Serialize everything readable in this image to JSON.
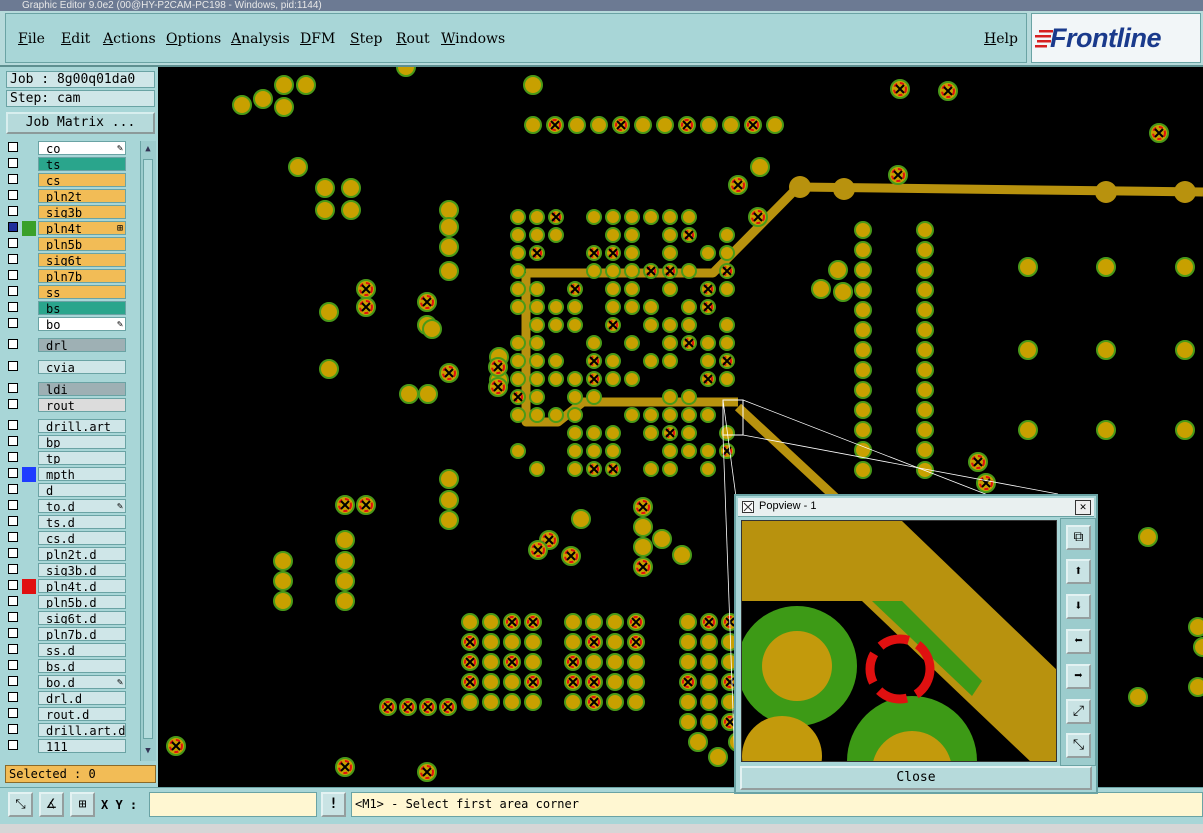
{
  "window": {
    "title": "Graphic Editor 9.0e2 (00@HY-P2CAM-PC198 - Windows, pid:1144)"
  },
  "menu": [
    "File",
    "Edit",
    "Actions",
    "Options",
    "Analysis",
    "DFM",
    "Step",
    "Rout",
    "Windows"
  ],
  "help_label": "Help",
  "logo": {
    "text": "Frontline",
    "color": "#1a3a8c",
    "accent": "#d62020"
  },
  "job": {
    "job_label": "Job : 8g00q01da0",
    "step_label": "Step: cam"
  },
  "job_matrix_label": "Job Matrix ...",
  "layers": [
    {
      "name": "co",
      "bg": "#ffffff",
      "flag": "✎",
      "marker": ""
    },
    {
      "name": "ts",
      "bg": "#2aa58c",
      "flag": "",
      "marker": ""
    },
    {
      "name": "cs",
      "bg": "#f2bc56",
      "flag": "",
      "marker": ""
    },
    {
      "name": "pln2t",
      "bg": "#f2bc56",
      "flag": "",
      "marker": ""
    },
    {
      "name": "sig3b",
      "bg": "#f2bc56",
      "flag": "",
      "marker": ""
    },
    {
      "name": "pln4t",
      "bg": "#f2bc56",
      "flag": "⊞",
      "marker": "#1e2f9c",
      "marker2": "#3aa02a"
    },
    {
      "name": "pln5b",
      "bg": "#f2bc56",
      "flag": "",
      "marker": ""
    },
    {
      "name": "sig6t",
      "bg": "#f2bc56",
      "flag": "",
      "marker": ""
    },
    {
      "name": "pln7b",
      "bg": "#f2bc56",
      "flag": "",
      "marker": ""
    },
    {
      "name": "ss",
      "bg": "#f2bc56",
      "flag": "",
      "marker": ""
    },
    {
      "name": "bs",
      "bg": "#2aa58c",
      "flag": "",
      "marker": ""
    },
    {
      "name": "bo",
      "bg": "#ffffff",
      "flag": "✎",
      "marker": ""
    },
    {
      "name": "drl",
      "bg": "#9eb0b4",
      "flag": "",
      "marker": ""
    },
    {
      "name": "cvia",
      "bg": "#cfe6e8",
      "flag": "",
      "marker": ""
    },
    {
      "name": "ldi",
      "bg": "#9eb0b4",
      "flag": "",
      "marker": ""
    },
    {
      "name": "rout",
      "bg": "#dcdcdc",
      "flag": "",
      "marker": ""
    },
    {
      "name": "drill.art",
      "bg": "#cfe6e8",
      "flag": "",
      "marker": ""
    },
    {
      "name": "bp",
      "bg": "#cfe6e8",
      "flag": "",
      "marker": ""
    },
    {
      "name": "tp",
      "bg": "#cfe6e8",
      "flag": "",
      "marker": ""
    },
    {
      "name": "mpth",
      "bg": "#cfe6e8",
      "flag": "",
      "marker": "#1e3cff"
    },
    {
      "name": "d",
      "bg": "#cfe6e8",
      "flag": "",
      "marker": ""
    },
    {
      "name": "to.d",
      "bg": "#cfe6e8",
      "flag": "✎",
      "marker": ""
    },
    {
      "name": "ts.d",
      "bg": "#cfe6e8",
      "flag": "",
      "marker": ""
    },
    {
      "name": "cs.d",
      "bg": "#cfe6e8",
      "flag": "",
      "marker": ""
    },
    {
      "name": "pln2t.d",
      "bg": "#cfe6e8",
      "flag": "",
      "marker": ""
    },
    {
      "name": "sig3b.d",
      "bg": "#cfe6e8",
      "flag": "",
      "marker": ""
    },
    {
      "name": "pln4t.d",
      "bg": "#cfe6e8",
      "flag": "",
      "marker": "#e01010"
    },
    {
      "name": "pln5b.d",
      "bg": "#cfe6e8",
      "flag": "",
      "marker": ""
    },
    {
      "name": "sig6t.d",
      "bg": "#cfe6e8",
      "flag": "",
      "marker": ""
    },
    {
      "name": "pln7b.d",
      "bg": "#cfe6e8",
      "flag": "",
      "marker": ""
    },
    {
      "name": "ss.d",
      "bg": "#cfe6e8",
      "flag": "",
      "marker": ""
    },
    {
      "name": "bs.d",
      "bg": "#cfe6e8",
      "flag": "",
      "marker": ""
    },
    {
      "name": "bo.d",
      "bg": "#cfe6e8",
      "flag": "✎",
      "marker": ""
    },
    {
      "name": "drl.d",
      "bg": "#cfe6e8",
      "flag": "",
      "marker": ""
    },
    {
      "name": "rout.d",
      "bg": "#cfe6e8",
      "flag": "",
      "marker": ""
    },
    {
      "name": "drill.art.d",
      "bg": "#cfe6e8",
      "flag": "",
      "marker": ""
    },
    {
      "name": "111",
      "bg": "#cfe6e8",
      "flag": "",
      "marker": ""
    }
  ],
  "selected_label": "Selected : 0",
  "bottom": {
    "xy_label": "X Y :",
    "xy_value": "",
    "message": "<M1> - Select first area corner",
    "bang": "!"
  },
  "popview": {
    "title": "Popview - 1",
    "close_label": "Close"
  },
  "colors": {
    "pad": "#c8a000",
    "pad_ring": "#4a9a18",
    "drill_mark": "#e01010",
    "trace": "#b8920e",
    "panel": "#a8d6d7"
  }
}
